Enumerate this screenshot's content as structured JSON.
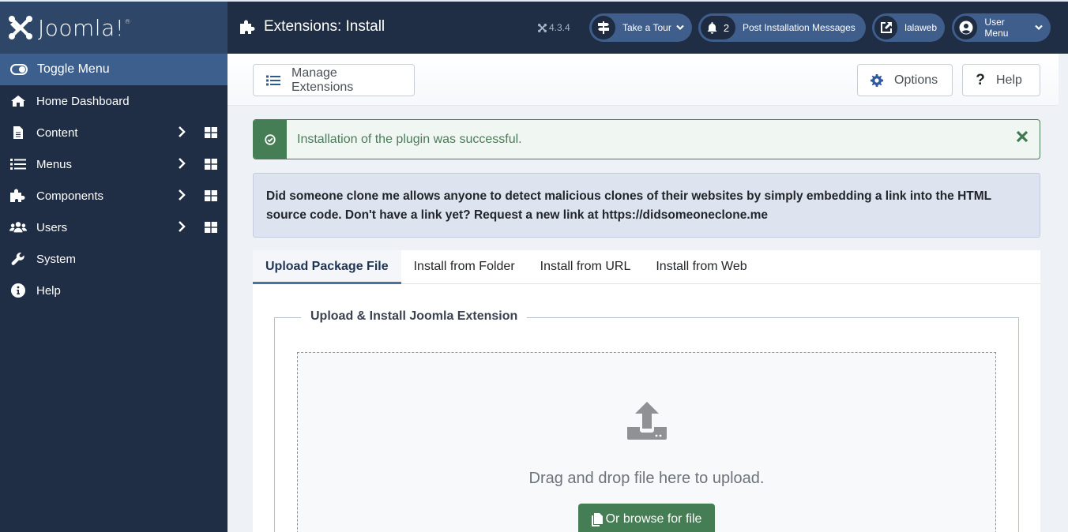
{
  "sidebar": {
    "logo_text": "Joomla!",
    "toggle_label": "Toggle Menu",
    "items": [
      {
        "label": "Home Dashboard",
        "icon": "home-icon",
        "has_submenu": false
      },
      {
        "label": "Content",
        "icon": "file-icon",
        "has_submenu": true
      },
      {
        "label": "Menus",
        "icon": "list-icon",
        "has_submenu": true
      },
      {
        "label": "Components",
        "icon": "puzzle-icon",
        "has_submenu": true
      },
      {
        "label": "Users",
        "icon": "users-icon",
        "has_submenu": true
      },
      {
        "label": "System",
        "icon": "wrench-icon",
        "has_submenu": false
      },
      {
        "label": "Help",
        "icon": "info-icon",
        "has_submenu": false
      }
    ]
  },
  "header": {
    "title": "Extensions: Install",
    "version": "4.3.4",
    "take_tour": "Take a Tour",
    "notifications_count": "2",
    "post_install": "Post Installation Messages",
    "site_link": "lalaweb",
    "user_menu": "User Menu"
  },
  "toolbar": {
    "manage_extensions": "Manage Extensions",
    "options": "Options",
    "help": "Help"
  },
  "alert": {
    "message": "Installation of the plugin was successful.",
    "type": "success"
  },
  "info": {
    "message": "Did someone clone me allows anyone to detect malicious clones of their websites by simply embedding a link into the HTML source code. Don't have a link yet? Request a new link at https://didsomeoneclone.me"
  },
  "tabs": [
    {
      "label": "Upload Package File",
      "active": true
    },
    {
      "label": "Install from Folder",
      "active": false
    },
    {
      "label": "Install from URL",
      "active": false
    },
    {
      "label": "Install from Web",
      "active": false
    }
  ],
  "upload": {
    "legend": "Upload & Install Joomla Extension",
    "drop_text": "Drag and drop file here to upload.",
    "browse_label": "Or browse for file"
  },
  "colors": {
    "sidebar_bg": "#1f2d45",
    "accent_blue": "#3f5e8b",
    "success_green": "#457d54"
  }
}
